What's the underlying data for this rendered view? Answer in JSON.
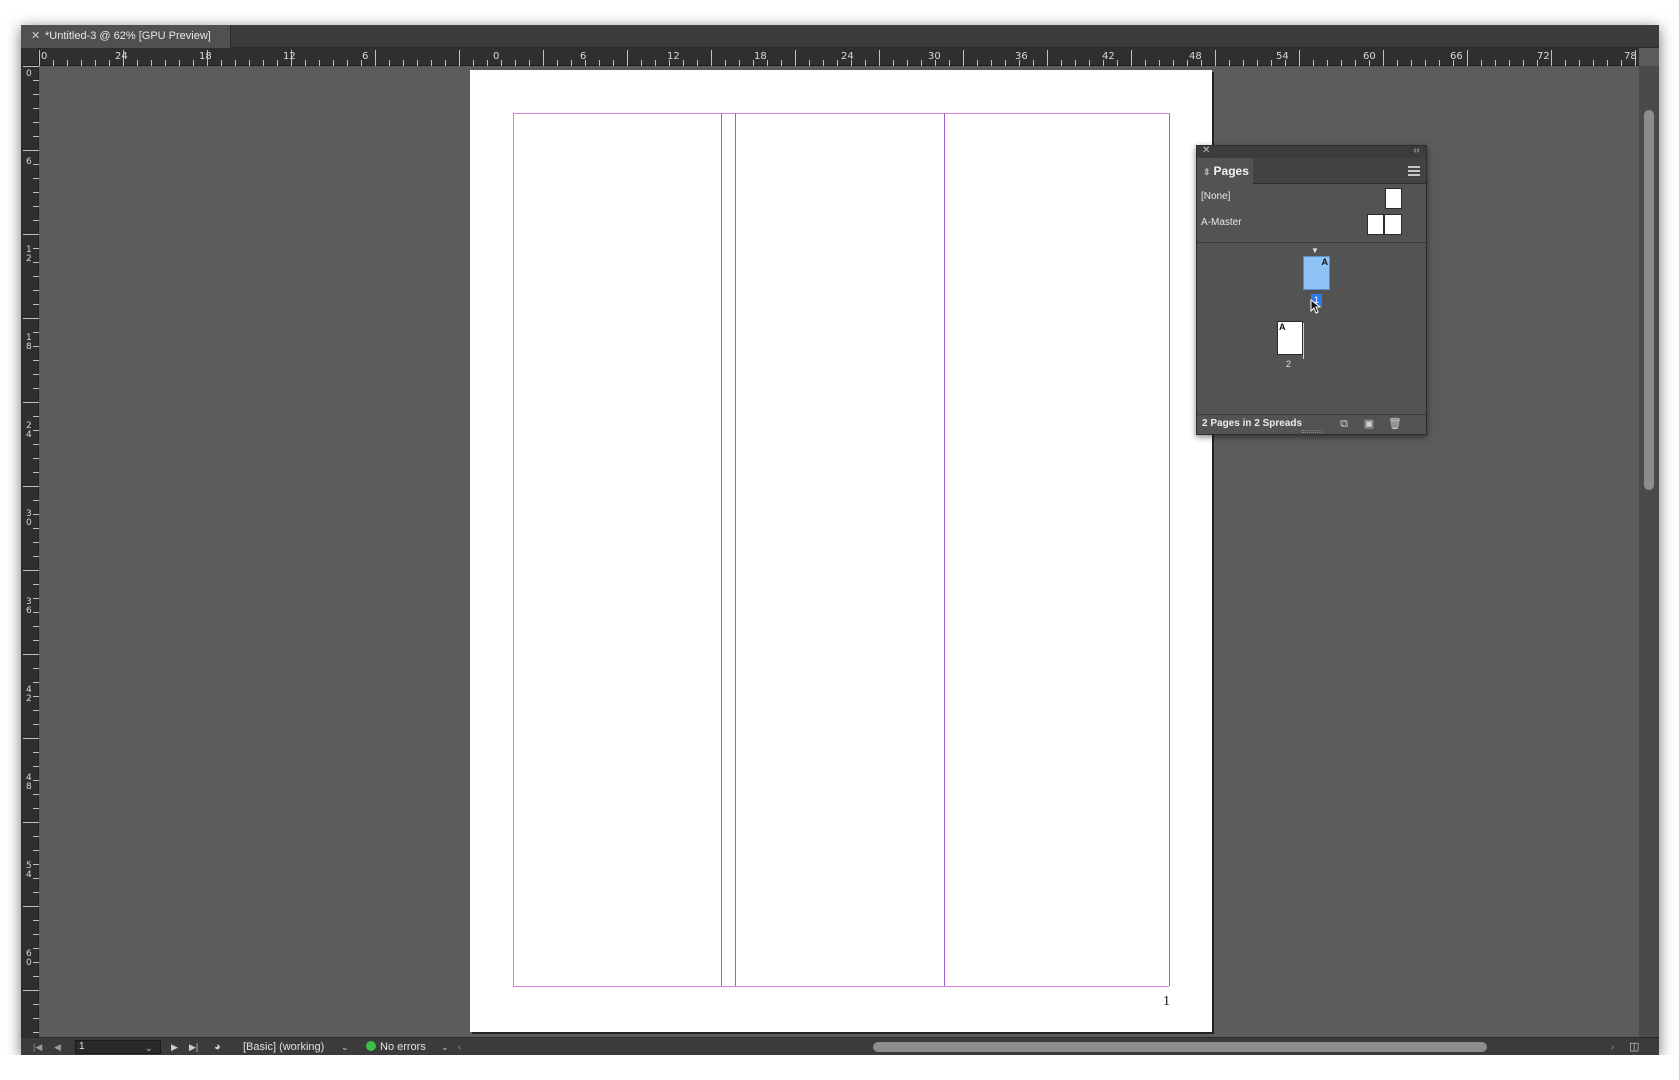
{
  "document_tab": {
    "close_glyph": "✕",
    "title": "*Untitled-3 @ 62% [GPU Preview]"
  },
  "ruler": {
    "horizontal_labels_left": [
      "0",
      "24",
      "18",
      "12",
      "6"
    ],
    "horizontal_labels_right": [
      "0",
      "6",
      "12",
      "18",
      "24",
      "30",
      "36",
      "42",
      "48",
      "54",
      "60",
      "66",
      "72",
      "78"
    ],
    "vertical_labels": [
      "0",
      "6",
      "1\n2",
      "1\n8",
      "2\n4",
      "3\n0",
      "3\n6",
      "4\n2",
      "4\n8",
      "5\n4",
      "6\n0"
    ]
  },
  "page": {
    "number": "1"
  },
  "pages_panel": {
    "tab_label": "Pages",
    "tab_icon": "⇕",
    "masters": [
      {
        "label": "[None]"
      },
      {
        "label": "A-Master"
      }
    ],
    "pages": [
      {
        "number": "1",
        "master": "A",
        "selected": true
      },
      {
        "number": "2",
        "master": "A",
        "selected": false
      }
    ],
    "footer_text": "2 Pages in 2 Spreads",
    "footer_icons": [
      "edit-page-size-icon",
      "new-page-icon",
      "delete-page-icon"
    ]
  },
  "status_bar": {
    "current_page": "1",
    "preflight_profile": "[Basic] (working)",
    "preflight_status": "No errors",
    "status_color": "#3fbf46"
  },
  "colors": {
    "margin_guide": "#df7fe0",
    "column_guide": "#9f5fc8",
    "selected_page": "#8ec4f5",
    "page_number_highlight": "#2f7ce6"
  }
}
